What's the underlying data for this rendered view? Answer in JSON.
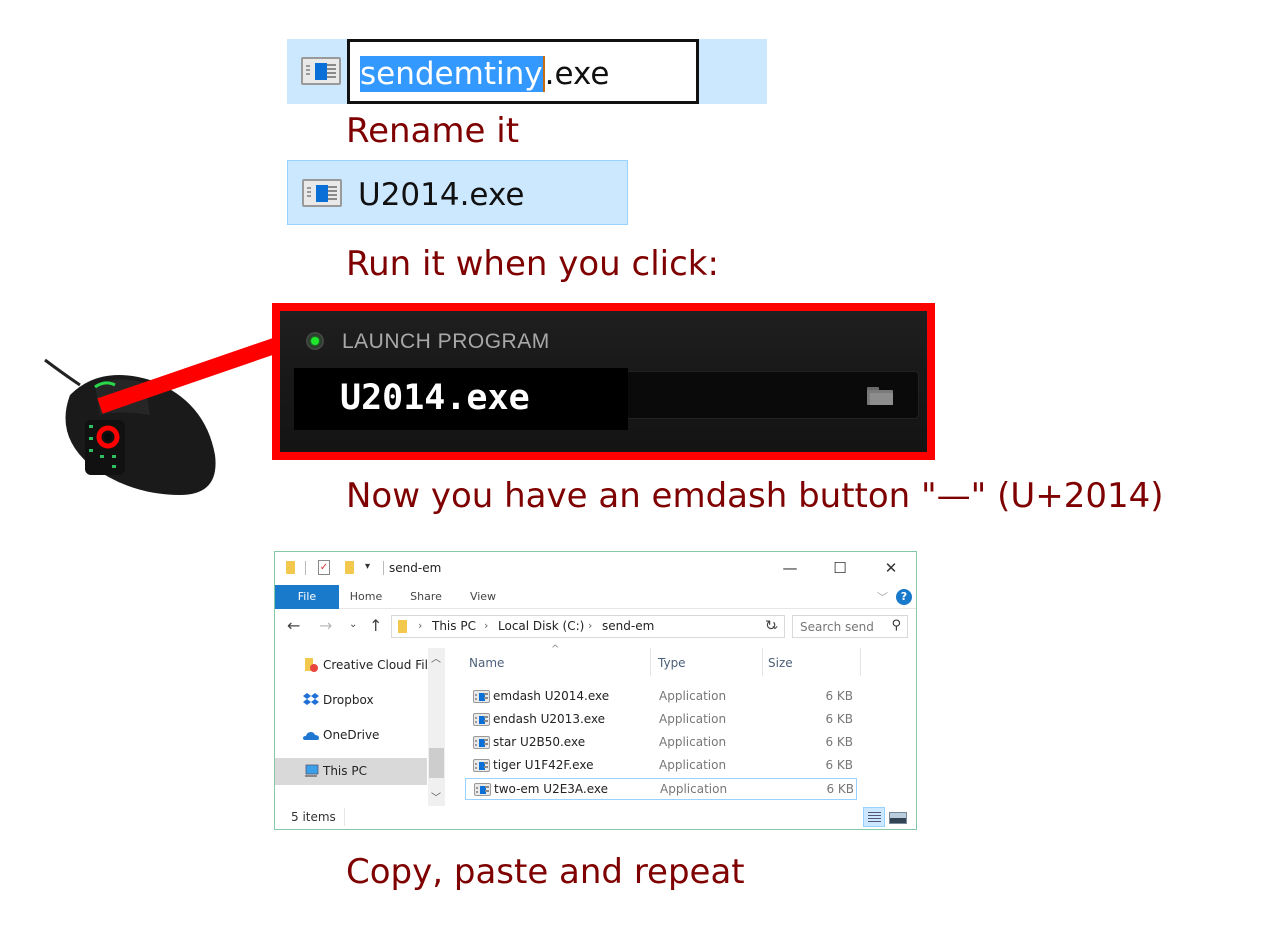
{
  "step1": {
    "rename_field": {
      "selected_text": "sendemtiny",
      "extension_text": ".exe"
    },
    "caption": "Rename it"
  },
  "step2": {
    "renamed_file": "U2014.exe",
    "caption": "Run it when you click:"
  },
  "launch_panel": {
    "label": "LAUNCH PROGRAM",
    "program_path": "U2014.exe",
    "status_color": "#1ee82c",
    "highlight_color": "#ff0000"
  },
  "result_caption": "Now you have an emdash button \"—\" (U+2014)",
  "explorer": {
    "title": "send-em",
    "window_buttons": {
      "minimize": "—",
      "maximize": "☐",
      "close": "✕"
    },
    "ribbon_tabs": [
      "File",
      "Home",
      "Share",
      "View"
    ],
    "help_label": "?",
    "address": {
      "crumbs": [
        "This PC",
        "Local Disk (C:)",
        "send-em"
      ]
    },
    "search_placeholder": "Search send",
    "nav_items": [
      {
        "label": "Creative Cloud Files",
        "icon": "creative-cloud-icon"
      },
      {
        "label": "Dropbox",
        "icon": "dropbox-icon"
      },
      {
        "label": "OneDrive",
        "icon": "onedrive-icon"
      },
      {
        "label": "This PC",
        "icon": "this-pc-icon",
        "selected": true
      }
    ],
    "columns": [
      "Name",
      "Type",
      "Size"
    ],
    "files": [
      {
        "name": "emdash U2014.exe",
        "type": "Application",
        "size": "6 KB"
      },
      {
        "name": "endash U2013.exe",
        "type": "Application",
        "size": "6 KB"
      },
      {
        "name": "star U2B50.exe",
        "type": "Application",
        "size": "6 KB"
      },
      {
        "name": "tiger U1F42F.exe",
        "type": "Application",
        "size": "6 KB"
      },
      {
        "name": "two-em U2E3A.exe",
        "type": "Application",
        "size": "6 KB"
      }
    ],
    "status": "5 items"
  },
  "final_caption": "Copy, paste and repeat",
  "caption_color": "#7f0000"
}
